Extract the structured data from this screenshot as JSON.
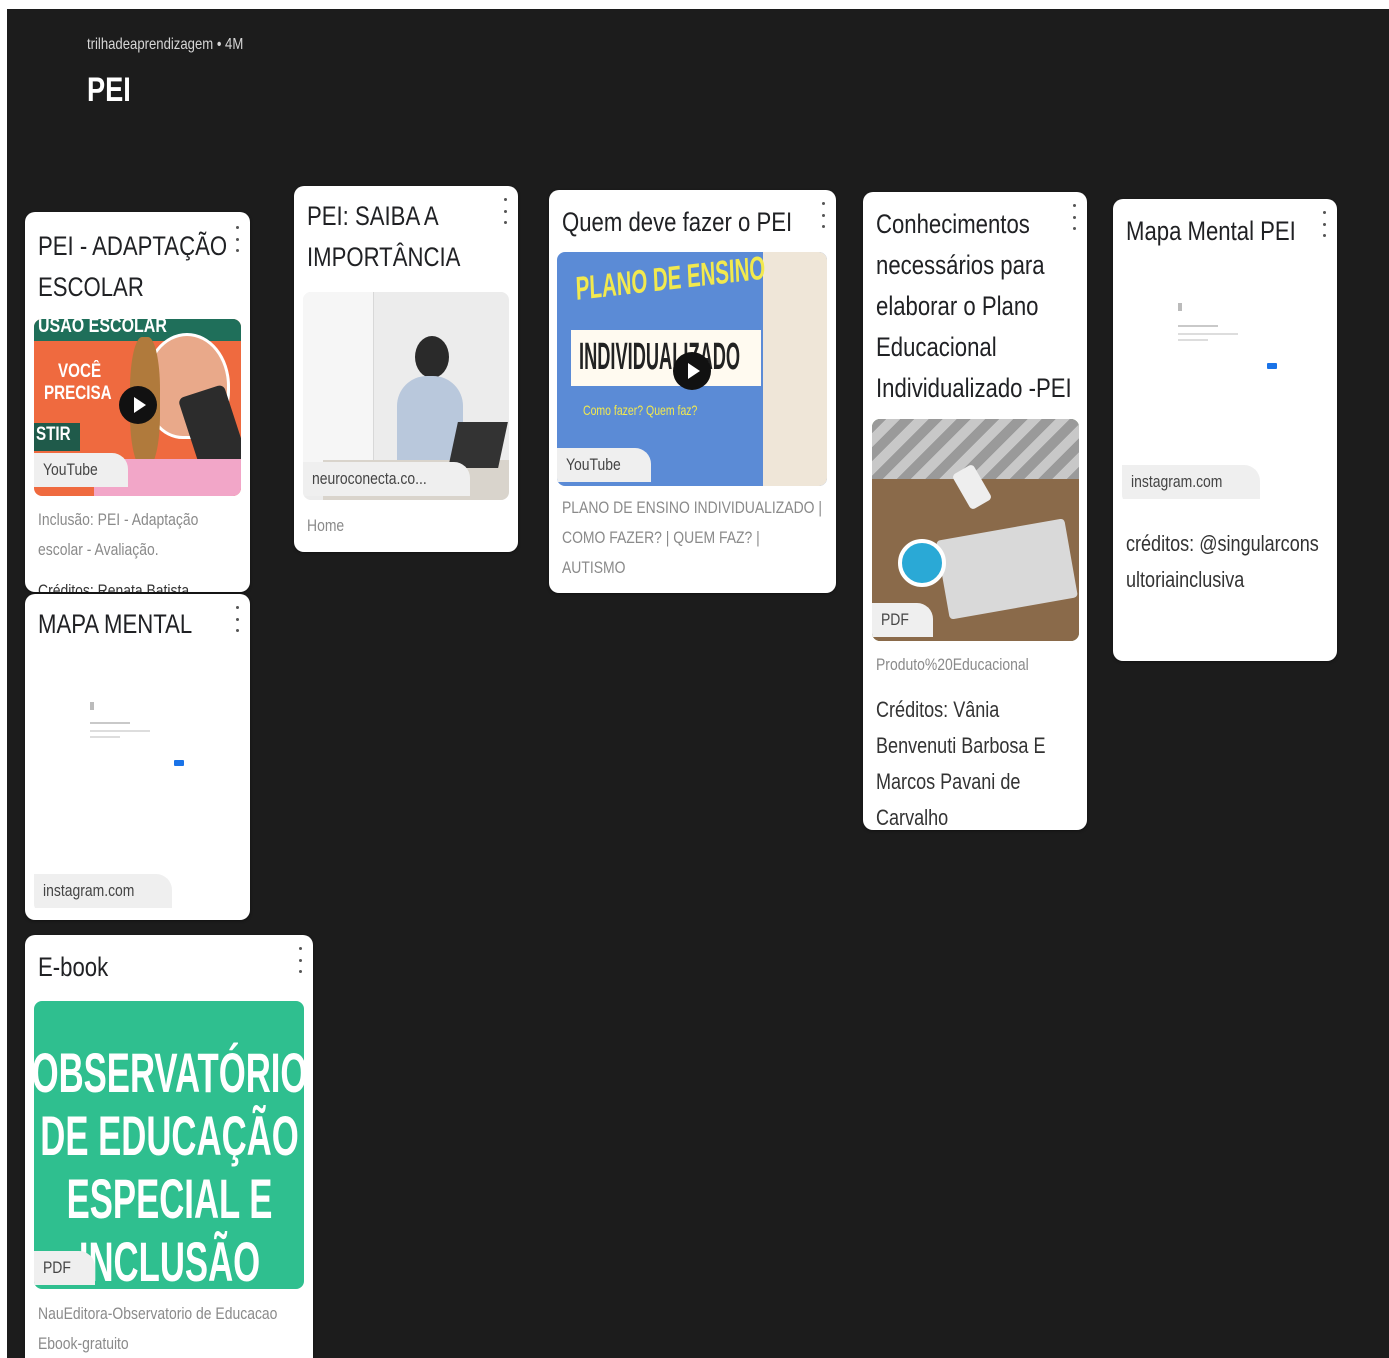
{
  "header": {
    "meta": "trilhadeaprendizagem • 4M",
    "title": "PEI"
  },
  "cards": [
    {
      "title": "PEI - ADAPTAÇÃO ESCOLAR",
      "thumb_text": [
        "USÃO ESCOLAR",
        "VOCÊ",
        "PRECISA",
        "STIR"
      ],
      "source": "YouTube",
      "description": "Inclusão: PEI - Adaptação escolar - Avaliação.",
      "extra": "Créditos: Renata Batista"
    },
    {
      "title": "PEI: SAIBA A IMPORTÂNCIA",
      "source": "neuroconecta.co...",
      "description": "Home"
    },
    {
      "title": "Quem deve fazer o PEI",
      "thumb_text": [
        "PLANO DE ENSINO",
        "INDIVIDUALIZADO",
        "Como fazer? Quem faz?"
      ],
      "source": "YouTube",
      "description": "PLANO DE ENSINO INDIVIDUALIZADO | COMO FAZER? | QUEM FAZ? | AUTISMO"
    },
    {
      "title": "Conhecimentos necessários para elaborar o Plano Educacional Individualizado -PEI",
      "source": "PDF",
      "description": "Produto%20Educacional",
      "body": "Créditos: Vânia Benvenuti Barbosa  E Marcos Pavani de Carvalho"
    },
    {
      "title": "Mapa Mental PEI",
      "source": "instagram.com",
      "body": "créditos: @singularconsultoriainclusiva"
    },
    {
      "title": "MAPA MENTAL",
      "source": "instagram.com"
    },
    {
      "title": "E-book",
      "thumb_text": "OBSERVATÓRIO DE EDUCAÇÃO ESPECIAL E INCLUSÃO",
      "source": "PDF",
      "description": "NauEditora-Observatorio de Educacao Ebook-gratuito"
    }
  ],
  "colors": {
    "board_bg": "#1c1c1c",
    "card_bg": "#ffffff",
    "ebook_green": "#2fbf8f",
    "youtube_thumb_orange": "#ef6a3f"
  },
  "icons": [
    "more-vert-icon",
    "play-icon"
  ]
}
